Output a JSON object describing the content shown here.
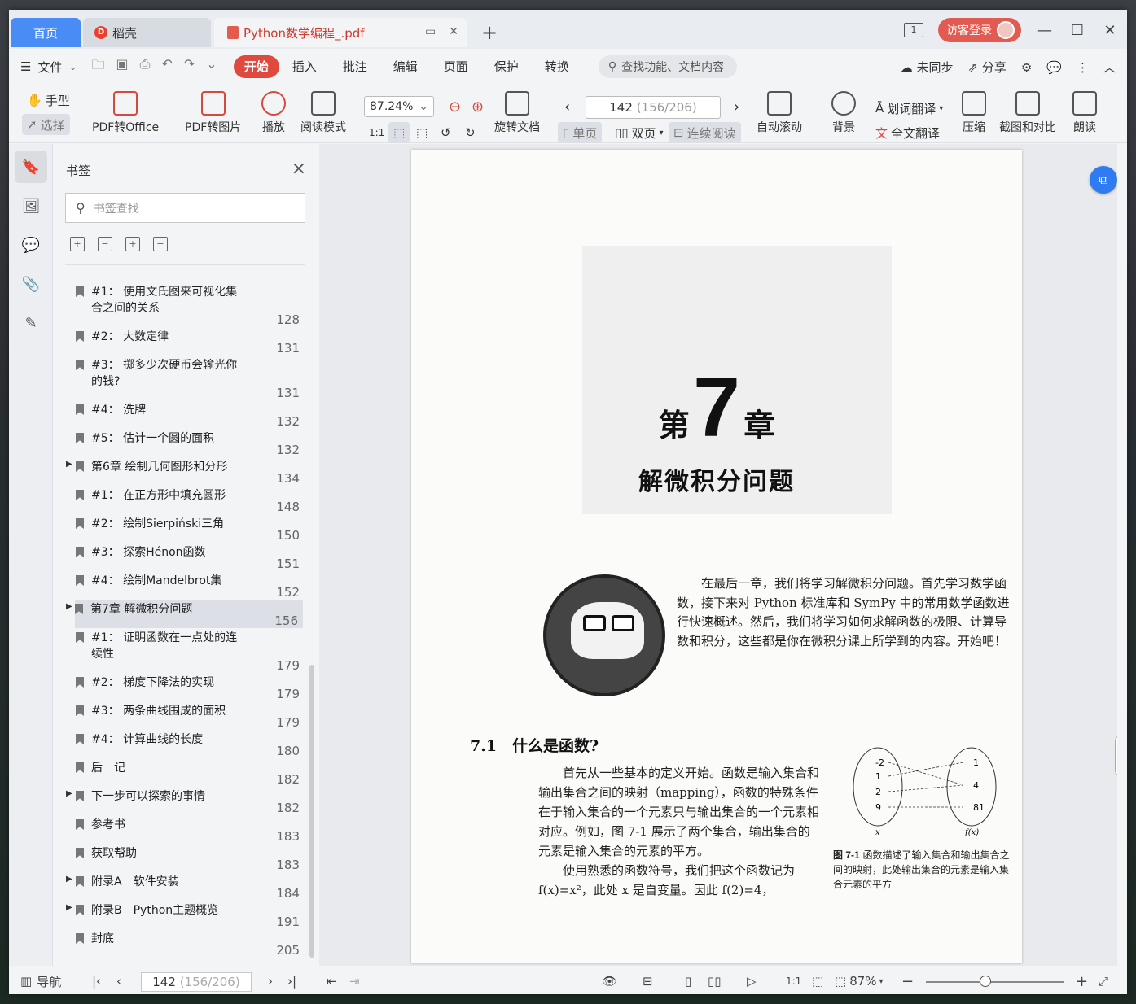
{
  "titlebar": {
    "tab_home": "首页",
    "tab_docer": "稻壳",
    "tab_doc": "Python数学编程_.pdf",
    "login_label": "访客登录"
  },
  "menubar": {
    "file_label": "文件",
    "tabs": [
      "开始",
      "插入",
      "批注",
      "编辑",
      "页面",
      "保护",
      "转换"
    ],
    "search_placeholder": "查找功能、文档内容",
    "sync_label": "未同步",
    "share_label": "分享"
  },
  "ribbon": {
    "hand": "手型",
    "select": "选择",
    "pdf_to_office": "PDF转Office",
    "pdf_to_image": "PDF转图片",
    "play": "播放",
    "read_mode": "阅读模式",
    "zoom": "87.24%",
    "rotate": "旋转文档",
    "page_current": "142",
    "page_meta": "(156/206)",
    "single": "单页",
    "double": "双页",
    "continuous": "连续阅读",
    "autoscroll": "自动滚动",
    "background": "背景",
    "word_translate": "划词翻译",
    "full_translate": "全文翻译",
    "compress": "压缩",
    "screenshot_compare": "截图和对比",
    "read_aloud": "朗读"
  },
  "bookmarks": {
    "title": "书签",
    "search_placeholder": "书签查找",
    "items": [
      {
        "label": "#1： 使用文氏图来可视化集合之间的关系",
        "page": "128",
        "arrow": ""
      },
      {
        "label": "#2： 大数定律",
        "page": "131",
        "arrow": ""
      },
      {
        "label": "#3： 掷多少次硬币会输光你的钱?",
        "page": "131",
        "arrow": ""
      },
      {
        "label": "#4： 洗牌",
        "page": "132",
        "arrow": ""
      },
      {
        "label": "#5： 估计一个圆的面积",
        "page": "132",
        "arrow": ""
      },
      {
        "label": "第6章 绘制几何图形和分形",
        "page": "134",
        "arrow": "▶"
      },
      {
        "label": "#1： 在正方形中填充圆形",
        "page": "148",
        "arrow": ""
      },
      {
        "label": "#2： 绘制Sierpiński三角",
        "page": "150",
        "arrow": ""
      },
      {
        "label": "#3： 探索Hénon函数",
        "page": "151",
        "arrow": ""
      },
      {
        "label": "#4： 绘制Mandelbrot集",
        "page": "152",
        "arrow": ""
      },
      {
        "label": "第7章 解微积分问题",
        "page": "156",
        "arrow": "▶"
      },
      {
        "label": "#1： 证明函数在一点处的连续性",
        "page": "179",
        "arrow": ""
      },
      {
        "label": "#2： 梯度下降法的实现",
        "page": "179",
        "arrow": ""
      },
      {
        "label": "#3： 两条曲线围成的面积",
        "page": "179",
        "arrow": ""
      },
      {
        "label": "#4： 计算曲线的长度",
        "page": "180",
        "arrow": ""
      },
      {
        "label": "后　记",
        "page": "182",
        "arrow": ""
      },
      {
        "label": "下一步可以探索的事情",
        "page": "182",
        "arrow": "▶"
      },
      {
        "label": "参考书",
        "page": "183",
        "arrow": ""
      },
      {
        "label": "获取帮助",
        "page": "183",
        "arrow": ""
      },
      {
        "label": "附录A　软件安装",
        "page": "184",
        "arrow": "▶"
      },
      {
        "label": "附录B　Python主题概览",
        "page": "191",
        "arrow": "▶"
      },
      {
        "label": "封底",
        "page": "205",
        "arrow": ""
      }
    ]
  },
  "page": {
    "chapter_prefix": "第",
    "chapter_num": "7",
    "chapter_suffix": "章",
    "chapter_title": "解微积分问题",
    "intro": "在最后一章，我们将学习解微积分问题。首先学习数学函数，接下来对 Python 标准库和 SymPy 中的常用数学函数进行快速概述。然后，我们将学习如何求解函数的极限、计算导数和积分，这些都是你在微积分课上所学到的内容。开始吧！",
    "section_title": "7.1　什么是函数?",
    "para1": "首先从一些基本的定义开始。函数是输入集合和输出集合之间的映射（mapping），函数的特殊条件在于输入集合的一个元素只与输出集合的一个元素相对应。例如，图 7-1 展示了两个集合，输出集合的元素是输入集合的元素的平方。",
    "para2": "使用熟悉的函数符号，我们把这个函数记为 f(x)=x²，此处 x 是自变量。因此 f(2)=4，",
    "fig_inputs": [
      "-2",
      "1",
      "2",
      "9"
    ],
    "fig_outputs": [
      "1",
      "4",
      "81"
    ],
    "fig_x_label": "x",
    "fig_fx_label": "f(x)",
    "fig_caption_num": "图 7-1",
    "fig_caption": "函数描述了输入集合和输出集合之间的映射，此处输出集合的元素是输入集合元素的平方"
  },
  "statusbar": {
    "nav_label": "导航",
    "page_current": "142",
    "page_meta": "(156/206)",
    "zoom": "87%"
  }
}
